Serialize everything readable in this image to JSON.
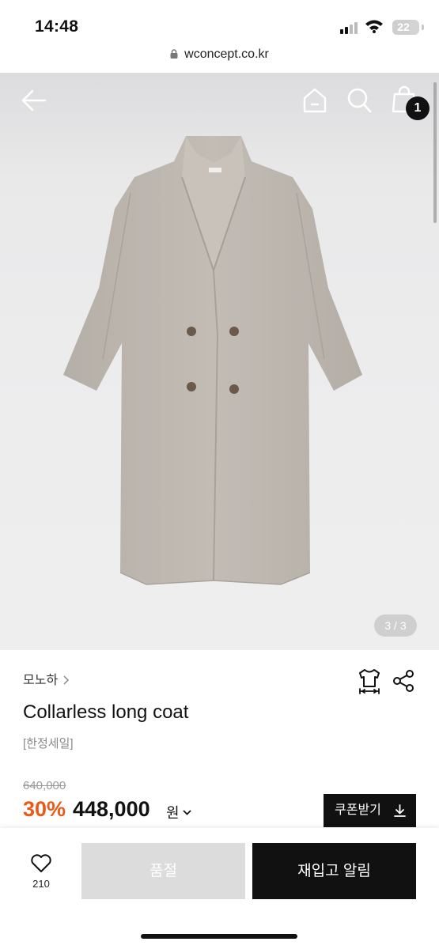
{
  "status_bar": {
    "time": "14:48",
    "battery": "22",
    "signal_icon": "signal-bars-icon",
    "wifi_icon": "wifi-icon"
  },
  "browser": {
    "url": "wconcept.co.kr",
    "lock_icon": "lock-icon"
  },
  "header": {
    "back_icon": "arrow-left-icon",
    "home_icon": "home-icon",
    "search_icon": "search-icon",
    "bag_icon": "shopping-bag-icon",
    "cart_count": "1"
  },
  "gallery": {
    "counter": "3 / 3",
    "current": 3,
    "total": 3
  },
  "product": {
    "brand": "모노하",
    "title": "Collarless long coat",
    "tag": "[한정세일]",
    "original_price": "640,000",
    "discount": "30%",
    "price": "448,000",
    "currency": "원",
    "size_icon": "size-guide-icon",
    "share_icon": "share-icon"
  },
  "coupon": {
    "label": "쿠폰받기",
    "icon": "download-icon"
  },
  "bottom_bar": {
    "like_count": "210",
    "like_icon": "heart-icon",
    "soldout_label": "품절",
    "restock_label": "재입고 알림"
  },
  "colors": {
    "discount": "#ea5a17",
    "primary": "#111111",
    "disabled": "#dcdcdc",
    "coat": "#bdb7b0"
  }
}
